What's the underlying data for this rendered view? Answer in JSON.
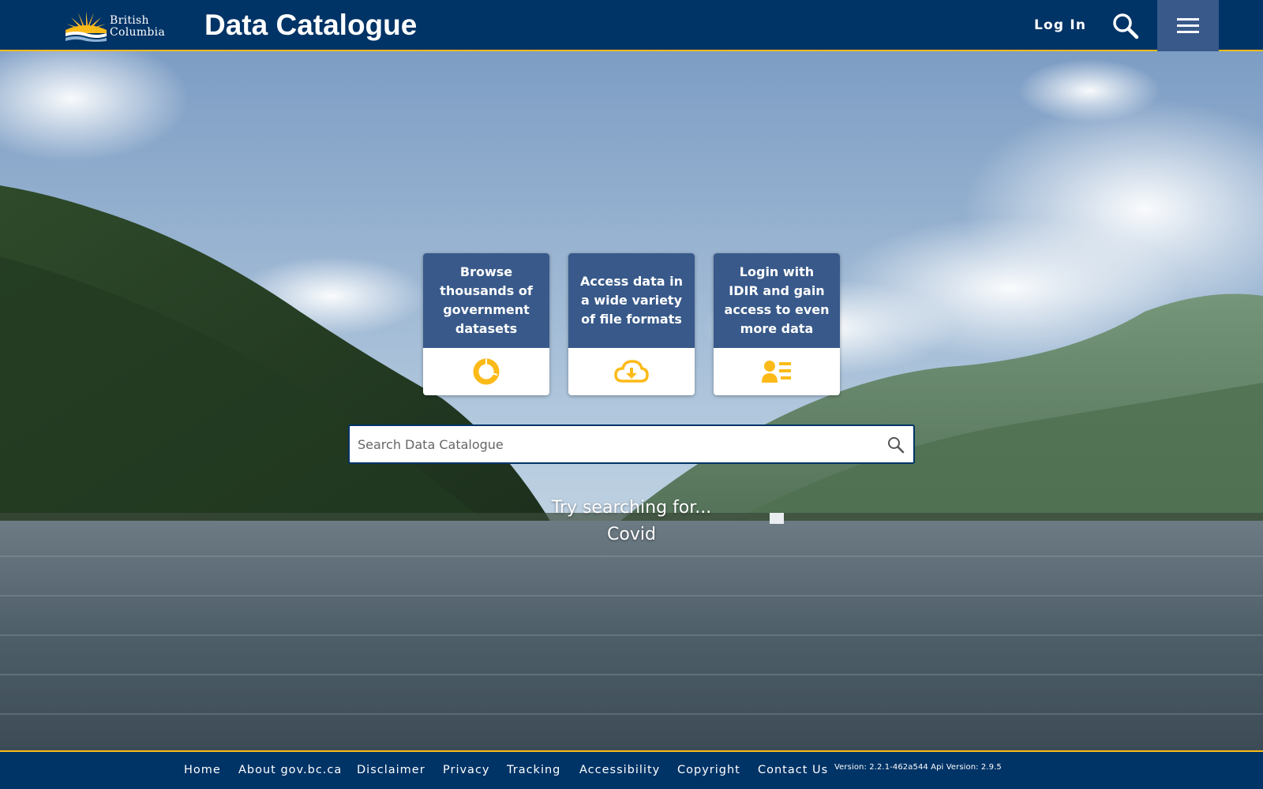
{
  "header": {
    "logo": {
      "line1": "British",
      "line2": "Columbia"
    },
    "title": "Data Catalogue",
    "login_label": "Log In",
    "search_icon": "search-icon",
    "menu_icon": "hamburger-menu-icon"
  },
  "cards": [
    {
      "text": "Browse thousands of government datasets",
      "icon": "donut-chart-icon"
    },
    {
      "text": "Access data in a wide variety of file formats",
      "icon": "cloud-download-icon"
    },
    {
      "text": "Login with IDIR and gain access to even more data",
      "icon": "user-list-icon"
    }
  ],
  "search": {
    "placeholder": "Search Data Catalogue",
    "value": "",
    "icon": "search-icon"
  },
  "suggestions": {
    "heading": "Try searching for...",
    "items": [
      "Covid"
    ]
  },
  "footer": {
    "links": [
      "Home",
      "About gov.bc.ca",
      "Disclaimer",
      "Privacy",
      "Tracking",
      "Accessibility",
      "Copyright",
      "Contact Us"
    ],
    "version": "Version: 2.2.1-462a544  Api Version: 2.9.5"
  },
  "colors": {
    "primary": "#003366",
    "card_blue": "#38598a",
    "accent_gold": "#fcba19"
  }
}
